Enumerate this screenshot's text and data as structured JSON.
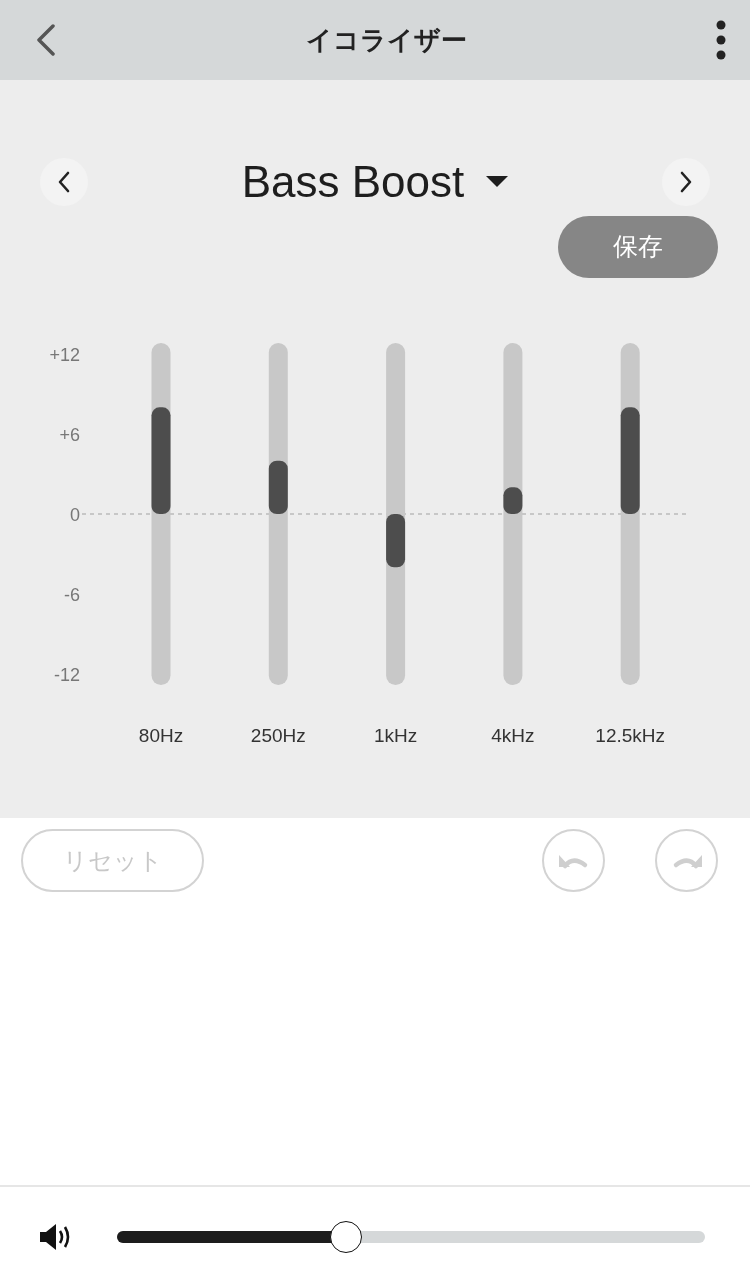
{
  "header": {
    "title": "イコライザー"
  },
  "preset": {
    "name": "Bass Boost"
  },
  "save_button": {
    "label": "保存"
  },
  "equalizer": {
    "chart_data": {
      "type": "bar",
      "categories": [
        "80Hz",
        "250Hz",
        "1kHz",
        "4kHz",
        "12.5kHz"
      ],
      "values": [
        8,
        4,
        -4,
        2,
        8
      ],
      "ylim": [
        -12,
        12
      ],
      "yticks": [
        {
          "value": 12,
          "label": "+12"
        },
        {
          "value": 6,
          "label": "+6"
        },
        {
          "value": 0,
          "label": "0"
        },
        {
          "value": -6,
          "label": "-6"
        },
        {
          "value": -12,
          "label": "-12"
        }
      ]
    }
  },
  "reset_button": {
    "label": "リセット",
    "disabled": true
  },
  "undo_button": {
    "disabled": true
  },
  "redo_button": {
    "disabled": true
  },
  "volume": {
    "level": 0.39
  }
}
